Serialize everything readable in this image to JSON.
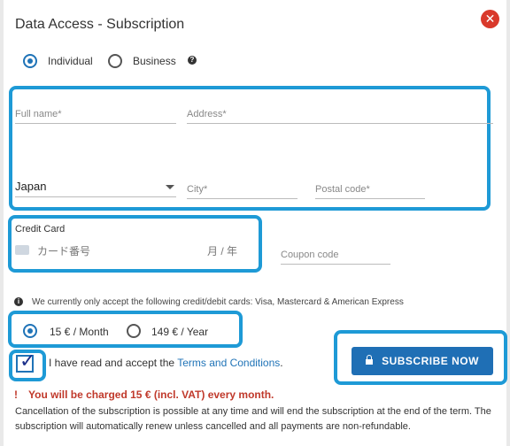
{
  "dialog": {
    "title": "Data Access - Subscription"
  },
  "account_type": {
    "options": [
      "Individual",
      "Business"
    ],
    "selected": "Individual"
  },
  "address": {
    "full_name_placeholder": "Full name*",
    "address_placeholder": "Address*",
    "country_value": "Japan",
    "city_placeholder": "City*",
    "postal_placeholder": "Postal code*"
  },
  "payment": {
    "section_label": "Credit Card",
    "card_number_placeholder": "カード番号",
    "expiry_placeholder": "月 / 年",
    "coupon_placeholder": "Coupon code",
    "accepted_cards_note": "We currently only accept the following credit/debit cards: Visa, Mastercard & American Express"
  },
  "plan": {
    "options": [
      "15 € / Month",
      "149 € / Year"
    ],
    "selected": "15 € / Month"
  },
  "terms": {
    "prefix": "I have read and accept the ",
    "link": "Terms and Conditions",
    "suffix": ".",
    "checked": true
  },
  "subscribe_button": "SUBSCRIBE NOW",
  "charge_notice": {
    "mark": "!",
    "text": "You will be charged 15 € (incl. VAT) every month."
  },
  "cancellation_note": "Cancellation of the subscription is possible at any time and will end the subscription at the end of the term. The subscription will automatically renew unless cancelled and all payments are non-refundable.",
  "colors": {
    "accent": "#1f6fb5",
    "highlight": "#1e9ad6",
    "warning": "#c0392b",
    "close": "#d9392b"
  },
  "icons": {
    "close": "close-icon",
    "help": "help-icon",
    "info": "info-icon",
    "lock": "lock-icon",
    "card": "credit-card-icon"
  }
}
